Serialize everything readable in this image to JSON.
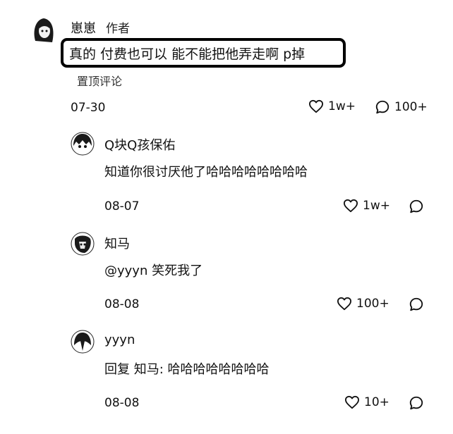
{
  "main_comment": {
    "author": "崽崽",
    "author_badge": "作者",
    "content": "真的 付费也可以 能不能把他弄走啊 p掉",
    "pinned_label": "置顶评论",
    "date": "07-30",
    "likes": "1w+",
    "replies": "100+"
  },
  "replies": [
    {
      "author": "Q块Q孩保佑",
      "content": "知道你很讨厌他了哈哈哈哈哈哈哈哈",
      "date": "08-07",
      "likes": "1w+"
    },
    {
      "author": "知马",
      "content": "@yyyn 笑死我了",
      "date": "08-08",
      "likes": "100+"
    },
    {
      "author": "yyyn",
      "content": "回复 知马: 哈哈哈哈哈哈哈哈",
      "date": "08-08",
      "likes": "10+"
    }
  ],
  "icons": {
    "like": "heart-icon",
    "reply": "comment-bubble-icon"
  }
}
